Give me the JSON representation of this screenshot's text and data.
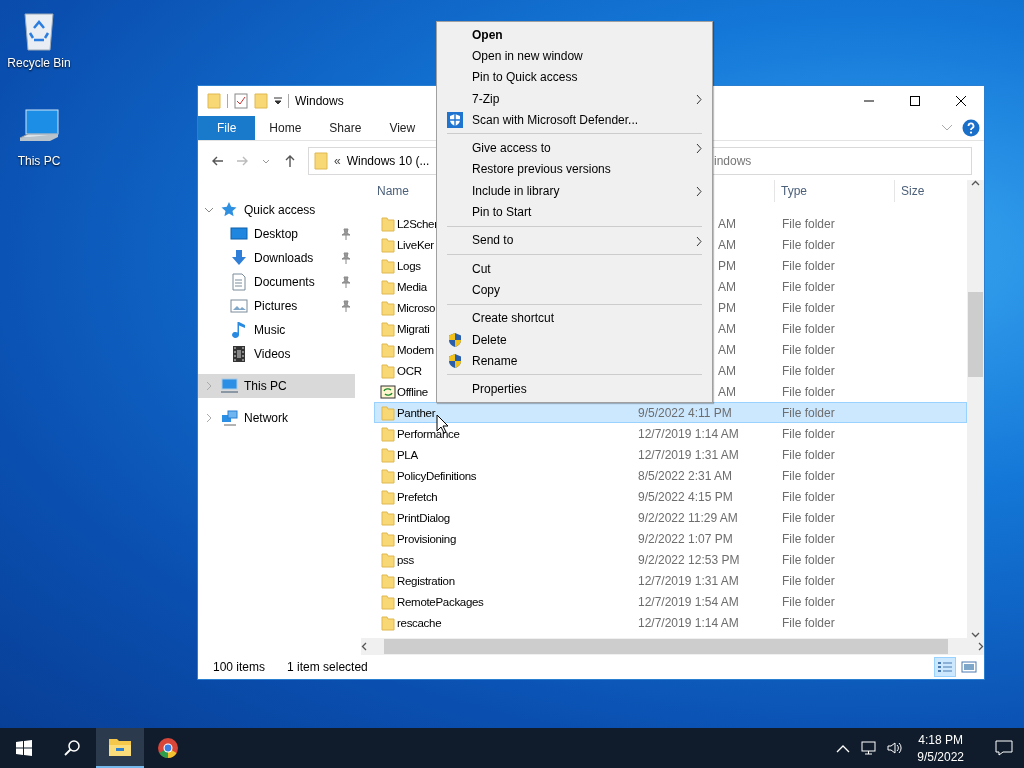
{
  "desktop_icons": [
    {
      "label": "Recycle Bin",
      "kind": "bin"
    },
    {
      "label": "This PC",
      "kind": "pc"
    }
  ],
  "window": {
    "title": "Windows",
    "ribbon_tabs": [
      {
        "label": "File",
        "selected": true
      },
      {
        "label": "Home",
        "selected": false
      },
      {
        "label": "Share",
        "selected": false
      },
      {
        "label": "View",
        "selected": false
      }
    ],
    "address": {
      "overflow_mark": "«",
      "path": "Windows 10 (..."
    },
    "search": {
      "placeholder": "indows"
    },
    "sidebar": {
      "items": [
        {
          "label": "Quick access",
          "expanded": true,
          "selected": false,
          "children": [
            {
              "label": "Desktop",
              "pinned": true,
              "selected": false
            },
            {
              "label": "Downloads",
              "pinned": true,
              "selected": false
            },
            {
              "label": "Documents",
              "pinned": true,
              "selected": false
            },
            {
              "label": "Pictures",
              "pinned": true,
              "selected": false
            },
            {
              "label": "Music",
              "pinned": false,
              "selected": false
            },
            {
              "label": "Videos",
              "pinned": false,
              "selected": false
            }
          ]
        },
        {
          "label": "This PC",
          "expanded": false,
          "selected": true
        },
        {
          "label": "Network",
          "expanded": false,
          "selected": false
        }
      ]
    },
    "table": {
      "columns": [
        {
          "label": "Name"
        },
        {
          "label": "Type"
        },
        {
          "label": "Size"
        }
      ],
      "rows": [
        {
          "name": "L2Scher",
          "kind": "folder",
          "date_end": "AM",
          "type": "File folder",
          "selected": false
        },
        {
          "name": "LiveKer",
          "kind": "folder",
          "date_end": "AM",
          "type": "File folder",
          "selected": false
        },
        {
          "name": "Logs",
          "kind": "folder",
          "date_end": "PM",
          "type": "File folder",
          "selected": false
        },
        {
          "name": "Media",
          "kind": "folder",
          "date_end": "AM",
          "type": "File folder",
          "selected": false
        },
        {
          "name": "Microso",
          "kind": "folder",
          "date_end": "PM",
          "type": "File folder",
          "selected": false
        },
        {
          "name": "Migrati",
          "kind": "folder",
          "date_end": "AM",
          "type": "File folder",
          "selected": false
        },
        {
          "name": "Modem",
          "kind": "folder",
          "date_end": "AM",
          "type": "File folder",
          "selected": false
        },
        {
          "name": "OCR",
          "kind": "folder",
          "date_end": "AM",
          "type": "File folder",
          "selected": false
        },
        {
          "name": "Offline",
          "kind": "sync",
          "date_end": "AM",
          "type": "File folder",
          "selected": false
        },
        {
          "name": "Panther",
          "kind": "folder",
          "date": "9/5/2022 4:11 PM",
          "type": "File folder",
          "selected": true
        },
        {
          "name": "Performance",
          "kind": "folder",
          "date": "12/7/2019 1:14 AM",
          "type": "File folder",
          "selected": false
        },
        {
          "name": "PLA",
          "kind": "folder",
          "date": "12/7/2019 1:31 AM",
          "type": "File folder",
          "selected": false
        },
        {
          "name": "PolicyDefinitions",
          "kind": "folder",
          "date": "8/5/2022 2:31 AM",
          "type": "File folder",
          "selected": false
        },
        {
          "name": "Prefetch",
          "kind": "folder",
          "date": "9/5/2022 4:15 PM",
          "type": "File folder",
          "selected": false
        },
        {
          "name": "PrintDialog",
          "kind": "folder",
          "date": "9/2/2022 11:29 AM",
          "type": "File folder",
          "selected": false
        },
        {
          "name": "Provisioning",
          "kind": "folder",
          "date": "9/2/2022 1:07 PM",
          "type": "File folder",
          "selected": false
        },
        {
          "name": "pss",
          "kind": "folder",
          "date": "9/2/2022 12:53 PM",
          "type": "File folder",
          "selected": false
        },
        {
          "name": "Registration",
          "kind": "folder",
          "date": "12/7/2019 1:31 AM",
          "type": "File folder",
          "selected": false
        },
        {
          "name": "RemotePackages",
          "kind": "folder",
          "date": "12/7/2019 1:54 AM",
          "type": "File folder",
          "selected": false
        },
        {
          "name": "rescache",
          "kind": "folder",
          "date": "12/7/2019 1:14 AM",
          "type": "File folder",
          "selected": false
        }
      ]
    },
    "status_bar": {
      "item_count": "100 items",
      "selection": "1 item selected",
      "view_buttons": [
        {
          "selected": true
        },
        {
          "selected": false
        }
      ]
    }
  },
  "context_menu": {
    "items": [
      {
        "kind": "item",
        "label": "Open",
        "default": true,
        "submenu": false
      },
      {
        "kind": "item",
        "label": "Open in new window",
        "default": false,
        "submenu": false
      },
      {
        "kind": "item",
        "label": "Pin to Quick access",
        "default": false,
        "submenu": false
      },
      {
        "kind": "item",
        "label": "7-Zip",
        "default": false,
        "submenu": true
      },
      {
        "kind": "scan",
        "label": "Scan with Microsoft Defender...",
        "default": false,
        "submenu": false
      },
      {
        "kind": "separator"
      },
      {
        "kind": "item",
        "label": "Give access to",
        "default": false,
        "submenu": true
      },
      {
        "kind": "item",
        "label": "Restore previous versions",
        "default": false,
        "submenu": false
      },
      {
        "kind": "item",
        "label": "Include in library",
        "default": false,
        "submenu": true
      },
      {
        "kind": "item",
        "label": "Pin to Start",
        "default": false,
        "submenu": false
      },
      {
        "kind": "separator"
      },
      {
        "kind": "item",
        "label": "Send to",
        "default": false,
        "submenu": true
      },
      {
        "kind": "separator"
      },
      {
        "kind": "item",
        "label": "Cut",
        "default": false,
        "submenu": false
      },
      {
        "kind": "item",
        "label": "Copy",
        "default": false,
        "submenu": false
      },
      {
        "kind": "separator"
      },
      {
        "kind": "item",
        "label": "Create shortcut",
        "default": false,
        "submenu": false
      },
      {
        "kind": "shield",
        "label": "Delete",
        "default": false,
        "submenu": false
      },
      {
        "kind": "shield",
        "label": "Rename",
        "default": false,
        "submenu": false
      },
      {
        "kind": "separator"
      },
      {
        "kind": "item",
        "label": "Properties",
        "default": false,
        "submenu": false
      }
    ]
  },
  "taskbar": {
    "apps": [
      {
        "kind": "explorer",
        "active": true
      },
      {
        "kind": "browser",
        "active": false
      }
    ],
    "clock": {
      "time": "4:18 PM",
      "date": "9/5/2022"
    }
  }
}
